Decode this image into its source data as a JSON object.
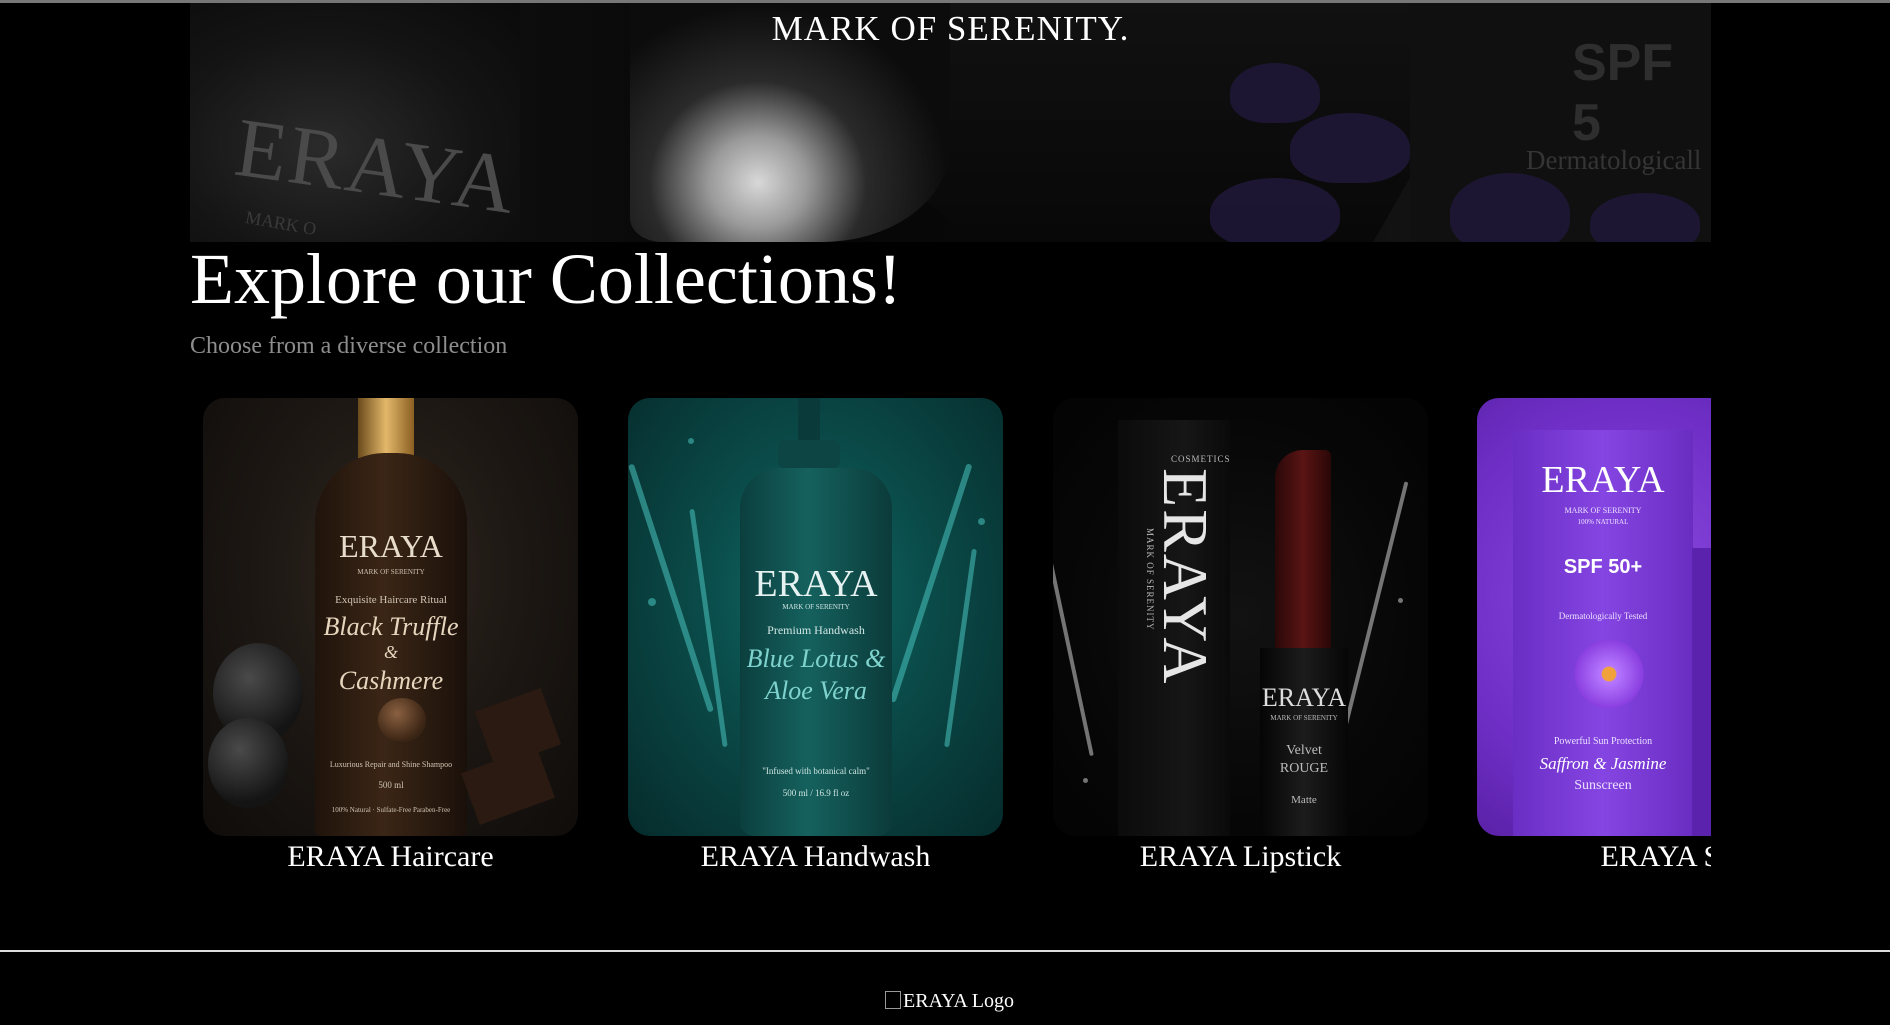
{
  "hero": {
    "tagline": "MARK OF SERENITY.",
    "image_text": {
      "brand": "ERAYA",
      "sub": "MARK O",
      "spf": "SPF 5",
      "derm": "Dermatologicall"
    }
  },
  "collections": {
    "title": "Explore our Collections!",
    "subtitle": "Choose from a diverse collection",
    "items": [
      {
        "label": "ERAYA Haircare",
        "packaging": {
          "brand": "ERAYA",
          "tag": "MARK OF SERENITY",
          "line1": "Exquisite Haircare Ritual",
          "script1": "Black Truffle",
          "script2": "&",
          "script3": "Cashmere",
          "line2": "Luxurious Repair and Shine Shampoo",
          "line3": "500 ml",
          "line4": "100% Natural · Sulfate-Free Paraben-Free"
        }
      },
      {
        "label": "ERAYA Handwash",
        "packaging": {
          "brand": "ERAYA",
          "tag": "MARK OF SERENITY",
          "line1": "Premium Handwash",
          "script1": "Blue Lotus &",
          "script2": "Aloe Vera",
          "line2": "\"Infused with botanical calm\"",
          "line3": "500 ml / 16.9 fl oz"
        }
      },
      {
        "label": "ERAYA Lipstick",
        "packaging": {
          "box_small": "COSMETICS",
          "box_brand": "ERAYA",
          "box_tag": "MARK OF SERENITY",
          "tube_brand": "ERAYA",
          "tube_tag": "MARK OF SERENITY",
          "line1": "Velvet",
          "line2": "ROUGE",
          "line3": "Matte"
        }
      },
      {
        "label": "ERAYA Sl",
        "packaging": {
          "brand": "ERAYA",
          "tag": "MARK OF SERENITY",
          "tag2": "100% NATURAL",
          "spf": "SPF 50+",
          "line1": "Dermatologically Tested",
          "line2": "Powerful Sun Protection",
          "script1": "Saffron & Jasmine",
          "script2": "Sunscreen"
        }
      }
    ]
  },
  "footer": {
    "logo_alt": "ERAYA Logo"
  }
}
